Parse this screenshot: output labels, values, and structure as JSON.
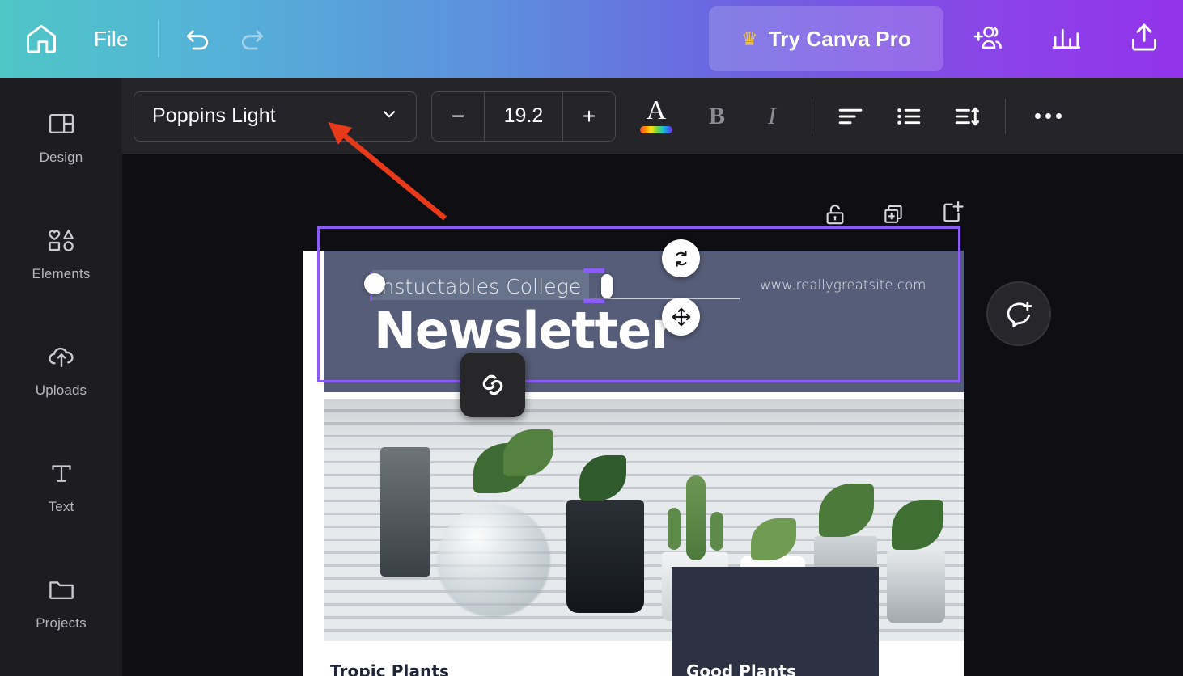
{
  "topbar": {
    "home_icon": "home-icon",
    "file_label": "File",
    "undo_icon": "undo-icon",
    "redo_icon": "redo-icon",
    "pro_button": {
      "label": "Try Canva Pro",
      "icon": "crown-icon",
      "glyph": "♛"
    },
    "share_icon": "add-collaborator-icon",
    "insights_icon": "bar-chart-icon",
    "publish_icon": "upload-publish-icon",
    "gradient": [
      "#4ec6c6",
      "#5d8fdd",
      "#9333ea"
    ]
  },
  "sidebar": {
    "items": [
      {
        "label": "Design",
        "icon": "layout-panels-icon"
      },
      {
        "label": "Elements",
        "icon": "shapes-icon"
      },
      {
        "label": "Uploads",
        "icon": "cloud-upload-icon"
      },
      {
        "label": "Text",
        "icon": "text-t-icon"
      },
      {
        "label": "Projects",
        "icon": "folder-icon"
      }
    ]
  },
  "toolbar": {
    "font_family": "Poppins Light",
    "font_dropdown_icon": "chevron-down-icon",
    "size_decrease": "−",
    "font_size": "19.2",
    "size_increase": "+",
    "text_color": {
      "icon": "font-color-icon",
      "glyph": "A"
    },
    "bold": "B",
    "italic": "I",
    "align_icon": "text-align-left-icon",
    "list_icon": "bulleted-list-icon",
    "spacing_icon": "line-spacing-icon",
    "more_icon": "more-options-icon"
  },
  "canvas": {
    "page_tools": [
      {
        "name": "lock-icon",
        "tooltip": "Lock"
      },
      {
        "name": "duplicate-icon",
        "tooltip": "Duplicate page"
      },
      {
        "name": "add-page-icon",
        "tooltip": "Add page"
      }
    ],
    "comment_fab_icon": "add-comment-icon",
    "selection": {
      "rotate_icon": "rotate-icon",
      "move_icon": "move-icon",
      "link_icon": "link-chain-icon",
      "border_color": "#8b5cf6"
    },
    "design": {
      "header_band_color": "#555d78",
      "college_text": "Instuctables College",
      "website_text": "www.reallygreatsite.com",
      "title_text": "Newsletter",
      "caption_left": "Tropic Plants",
      "caption_right": "Good Plants",
      "dark_card_color": "#2c3144"
    }
  },
  "annotation": {
    "arrow_color": "#e8391b",
    "points_to": "font-family-dropdown"
  }
}
